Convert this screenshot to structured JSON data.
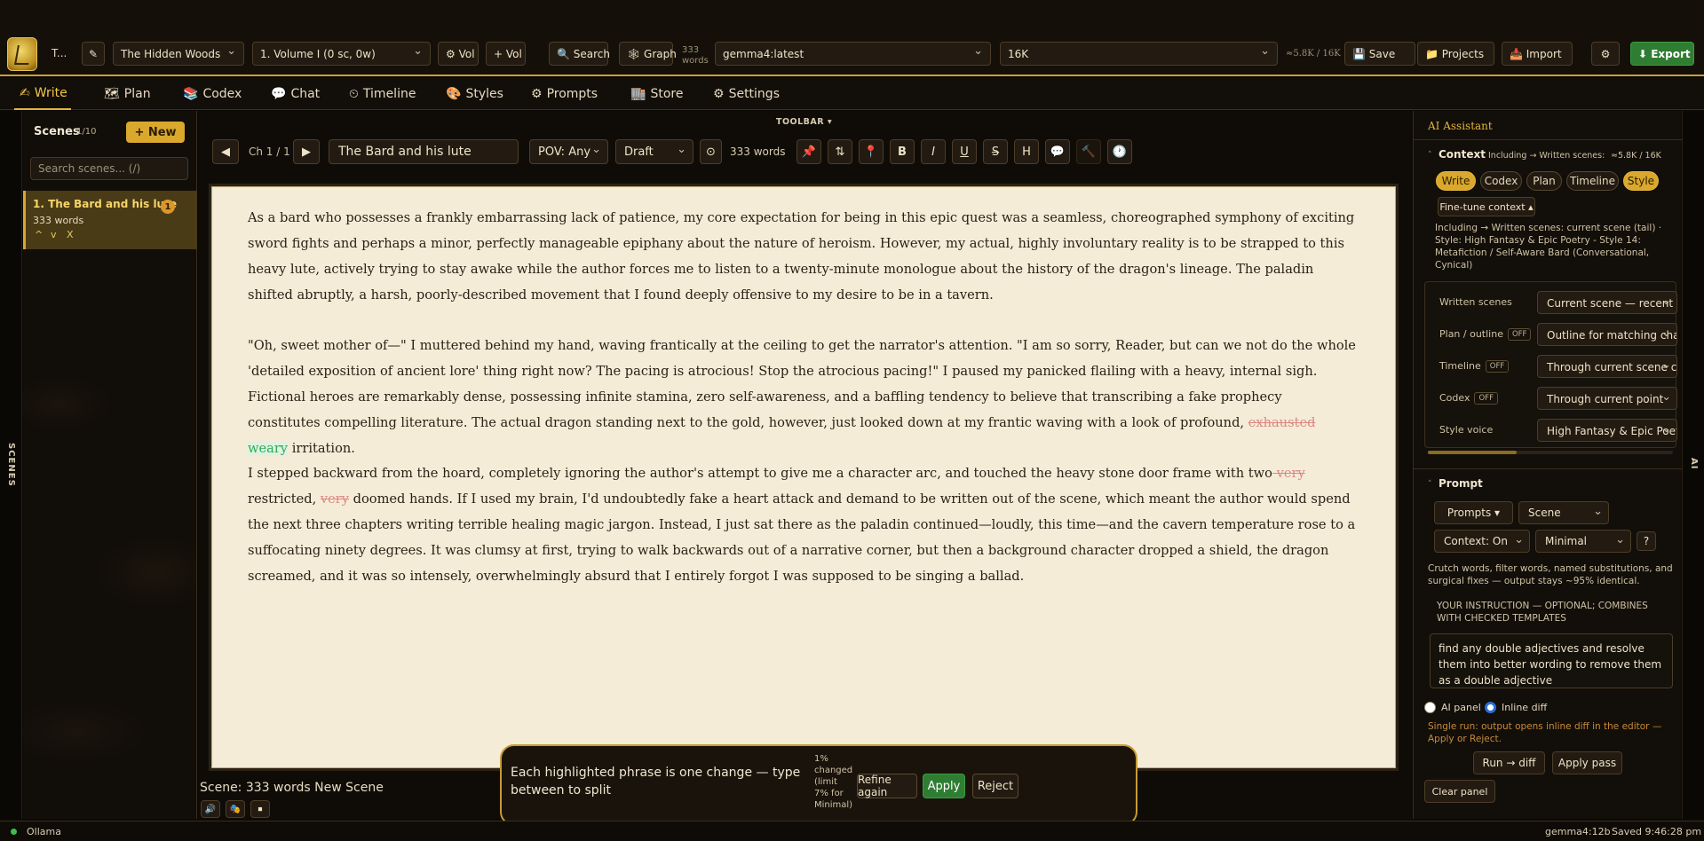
{
  "topbar": {
    "project_short": "T...",
    "pen_icon": "pen-icon",
    "project_select": "The Hidden Woods",
    "volume_select": "1. Volume I (0 sc, 0w)",
    "vol_settings": "⚙ Vol",
    "add_vol": "+ Vol",
    "search": "🔍 Search",
    "graph": "🕸 Graph",
    "words_count": "333",
    "words_label": "words",
    "model_select": "gemma4:latest",
    "context_select": "16K",
    "token_meter": "≈5.8K / 16K",
    "save": "💾 Save",
    "projects": "📁 Projects",
    "import": "📥 Import",
    "settings_icon": "⚙",
    "export": "⬇ Export"
  },
  "nav": {
    "tabs": [
      {
        "icon": "✍",
        "label": "Write",
        "active": true
      },
      {
        "icon": "🗺",
        "label": "Plan"
      },
      {
        "icon": "📚",
        "label": "Codex"
      },
      {
        "icon": "💬",
        "label": "Chat"
      },
      {
        "icon": "⏲",
        "label": "Timeline"
      },
      {
        "icon": "🎨",
        "label": "Styles"
      },
      {
        "icon": "⚙",
        "label": "Prompts"
      },
      {
        "icon": "🏬",
        "label": "Store"
      },
      {
        "icon": "⚙",
        "label": "Settings"
      }
    ]
  },
  "scenes_strip": {
    "label": "SCENES"
  },
  "scenes": {
    "title": "Scenes",
    "count": "1/10",
    "new_button": "+ New",
    "search_placeholder": "Search scenes... (/)",
    "items": [
      {
        "title": "1. The Bard and his lute",
        "badge": "1",
        "words": "333 words",
        "controls": [
          "^",
          "v",
          "X"
        ]
      }
    ]
  },
  "editor": {
    "toolbar_label": "TOOLBAR ▾",
    "prev": "◀",
    "chapter": "Ch 1 / 1",
    "next": "▶",
    "scene_title": "The Bard and his lute",
    "pov_select": "POV: Any",
    "status_select": "Draft",
    "word_count": "333 words",
    "format_buttons": [
      "📌",
      "⇅",
      "📍",
      "B",
      "I",
      "U",
      "S",
      "H",
      "💬",
      "🔨",
      "🕐"
    ],
    "paragraphs": [
      [
        {
          "text": "As a bard who possesses a frankly embarrassing lack of patience, my core expectation for being in this epic quest was a seamless, choreographed symphony of exciting sword fights and perhaps a minor, perfectly manageable epiphany about the nature of heroism. However, my actual, highly involuntary reality is to be strapped to this heavy lute, actively trying to stay awake while the author forces me to listen to a twenty-minute monologue about the history of the dragon's lineage. The paladin shifted abruptly, a harsh, poorly-described movement that I found deeply offensive to my desire to be in a tavern."
        }
      ],
      [
        {
          "text": "\"Oh, sweet mother of—\" I muttered behind my hand, waving frantically at the ceiling to get the narrator's attention. \"I am so sorry, Reader, but can we not do the whole 'detailed exposition of ancient lore' thing right now? The pacing is atrocious! Stop the atrocious pacing!\" I paused my panicked flailing with a heavy, internal sigh. Fictional heroes are remarkably dense, possessing infinite stamina, zero self-awareness, and a baffling tendency to believe that transcribing a fake prophecy constitutes compelling literature. The actual dragon standing next to the gold, however, just looked down at my frantic waving with a look of profound, "
        },
        {
          "text": "exhausted",
          "type": "del"
        },
        {
          "text": " "
        },
        {
          "text": "weary",
          "type": "ins"
        },
        {
          "text": " irritation."
        }
      ],
      [
        {
          "text": "I stepped backward from the hoard, completely ignoring the author's attempt to give me a character arc, and touched the heavy stone door frame with two"
        },
        {
          "text": " very",
          "type": "del"
        },
        {
          "text": " restricted, "
        },
        {
          "text": "very",
          "type": "del"
        },
        {
          "text": " doomed hands. If I used my brain, I'd undoubtedly fake a heart attack and demand to be written out of the scene, which meant the author would spend the next three chapters writing terrible healing magic jargon. Instead, I just sat there as the paladin continued—loudly, this time—and the cavern temperature rose to a suffocating ninety degrees. It was clumsy at first, trying to walk backwards out of a narrative corner, but then a background character dropped a shield, the dragon screamed, and it was so intensely, overwhelmingly absurd that I entirely forgot I was supposed to be singing a ballad."
        }
      ]
    ],
    "diff_bar": {
      "message": "Each highlighted phrase is one change — type between to split",
      "stat": "1% changed (limit 7% for Minimal)",
      "refine": "Refine again",
      "apply": "Apply",
      "reject": "Reject"
    },
    "footer_text": "Scene: 333 words New Scene",
    "footer_buttons": [
      "🔊",
      "🎭",
      "⏹"
    ]
  },
  "ai_strip": {
    "label": "AI"
  },
  "ai": {
    "title": "AI Assistant",
    "context": {
      "header": "Context",
      "header_sub": "Including → Written scenes: cu...",
      "meter": "≈5.8K / 16K",
      "pills": [
        {
          "label": "Write",
          "on": true
        },
        {
          "label": "Codex"
        },
        {
          "label": "Plan"
        },
        {
          "label": "Timeline"
        },
        {
          "label": "Style",
          "on": true
        }
      ],
      "fine_tune": "Fine-tune context ▴",
      "summary": "Including → Written scenes: current scene (tail) · Style: High Fantasy & Epic Poetry - Style 14: Metafiction / Self-Aware Bard (Conversational, Cynical)",
      "rows": [
        {
          "label": "Written scenes",
          "off": "",
          "value": "Current scene — recent te"
        },
        {
          "label": "Plan / outline",
          "off": "OFF",
          "value": "Outline for matching cha"
        },
        {
          "label": "Timeline",
          "off": "OFF",
          "value": "Through current scene ch"
        },
        {
          "label": "Codex",
          "off": "OFF",
          "value": "Through current point"
        },
        {
          "label": "Style voice",
          "off": "",
          "value": "High Fantasy & Epic Poetr"
        }
      ]
    },
    "prompt": {
      "header": "Prompt",
      "prompts_btn": "Prompts ▾",
      "scene_select": "Scene",
      "context_select": "Context: On",
      "level_select": "Minimal",
      "help": "?",
      "description": "Crutch words, filter words, named substitutions, and surgical fixes — output stays ~95% identical.",
      "instruction_label": "YOUR INSTRUCTION — OPTIONAL; COMBINES WITH CHECKED TEMPLATES",
      "instruction_value": "find any double adjectives and resolve them into better wording to remove them as a double adjective",
      "radio_panel": "AI panel",
      "radio_inline": "Inline diff",
      "note": "Single run: output opens inline diff in the editor — Apply or Reject.",
      "run": "Run → diff",
      "apply_pass": "Apply pass",
      "clear": "Clear panel"
    }
  },
  "status": {
    "provider": "Ollama",
    "model": "gemma4:12b",
    "saved": "Saved 9:46:28 pm"
  },
  "colors": {
    "accent": "#d9a82c",
    "bg": "#0c0906",
    "paper": "#f5ecd8",
    "green": "#2f7d32",
    "ins": "#2faa57",
    "del": "#d98a84"
  }
}
